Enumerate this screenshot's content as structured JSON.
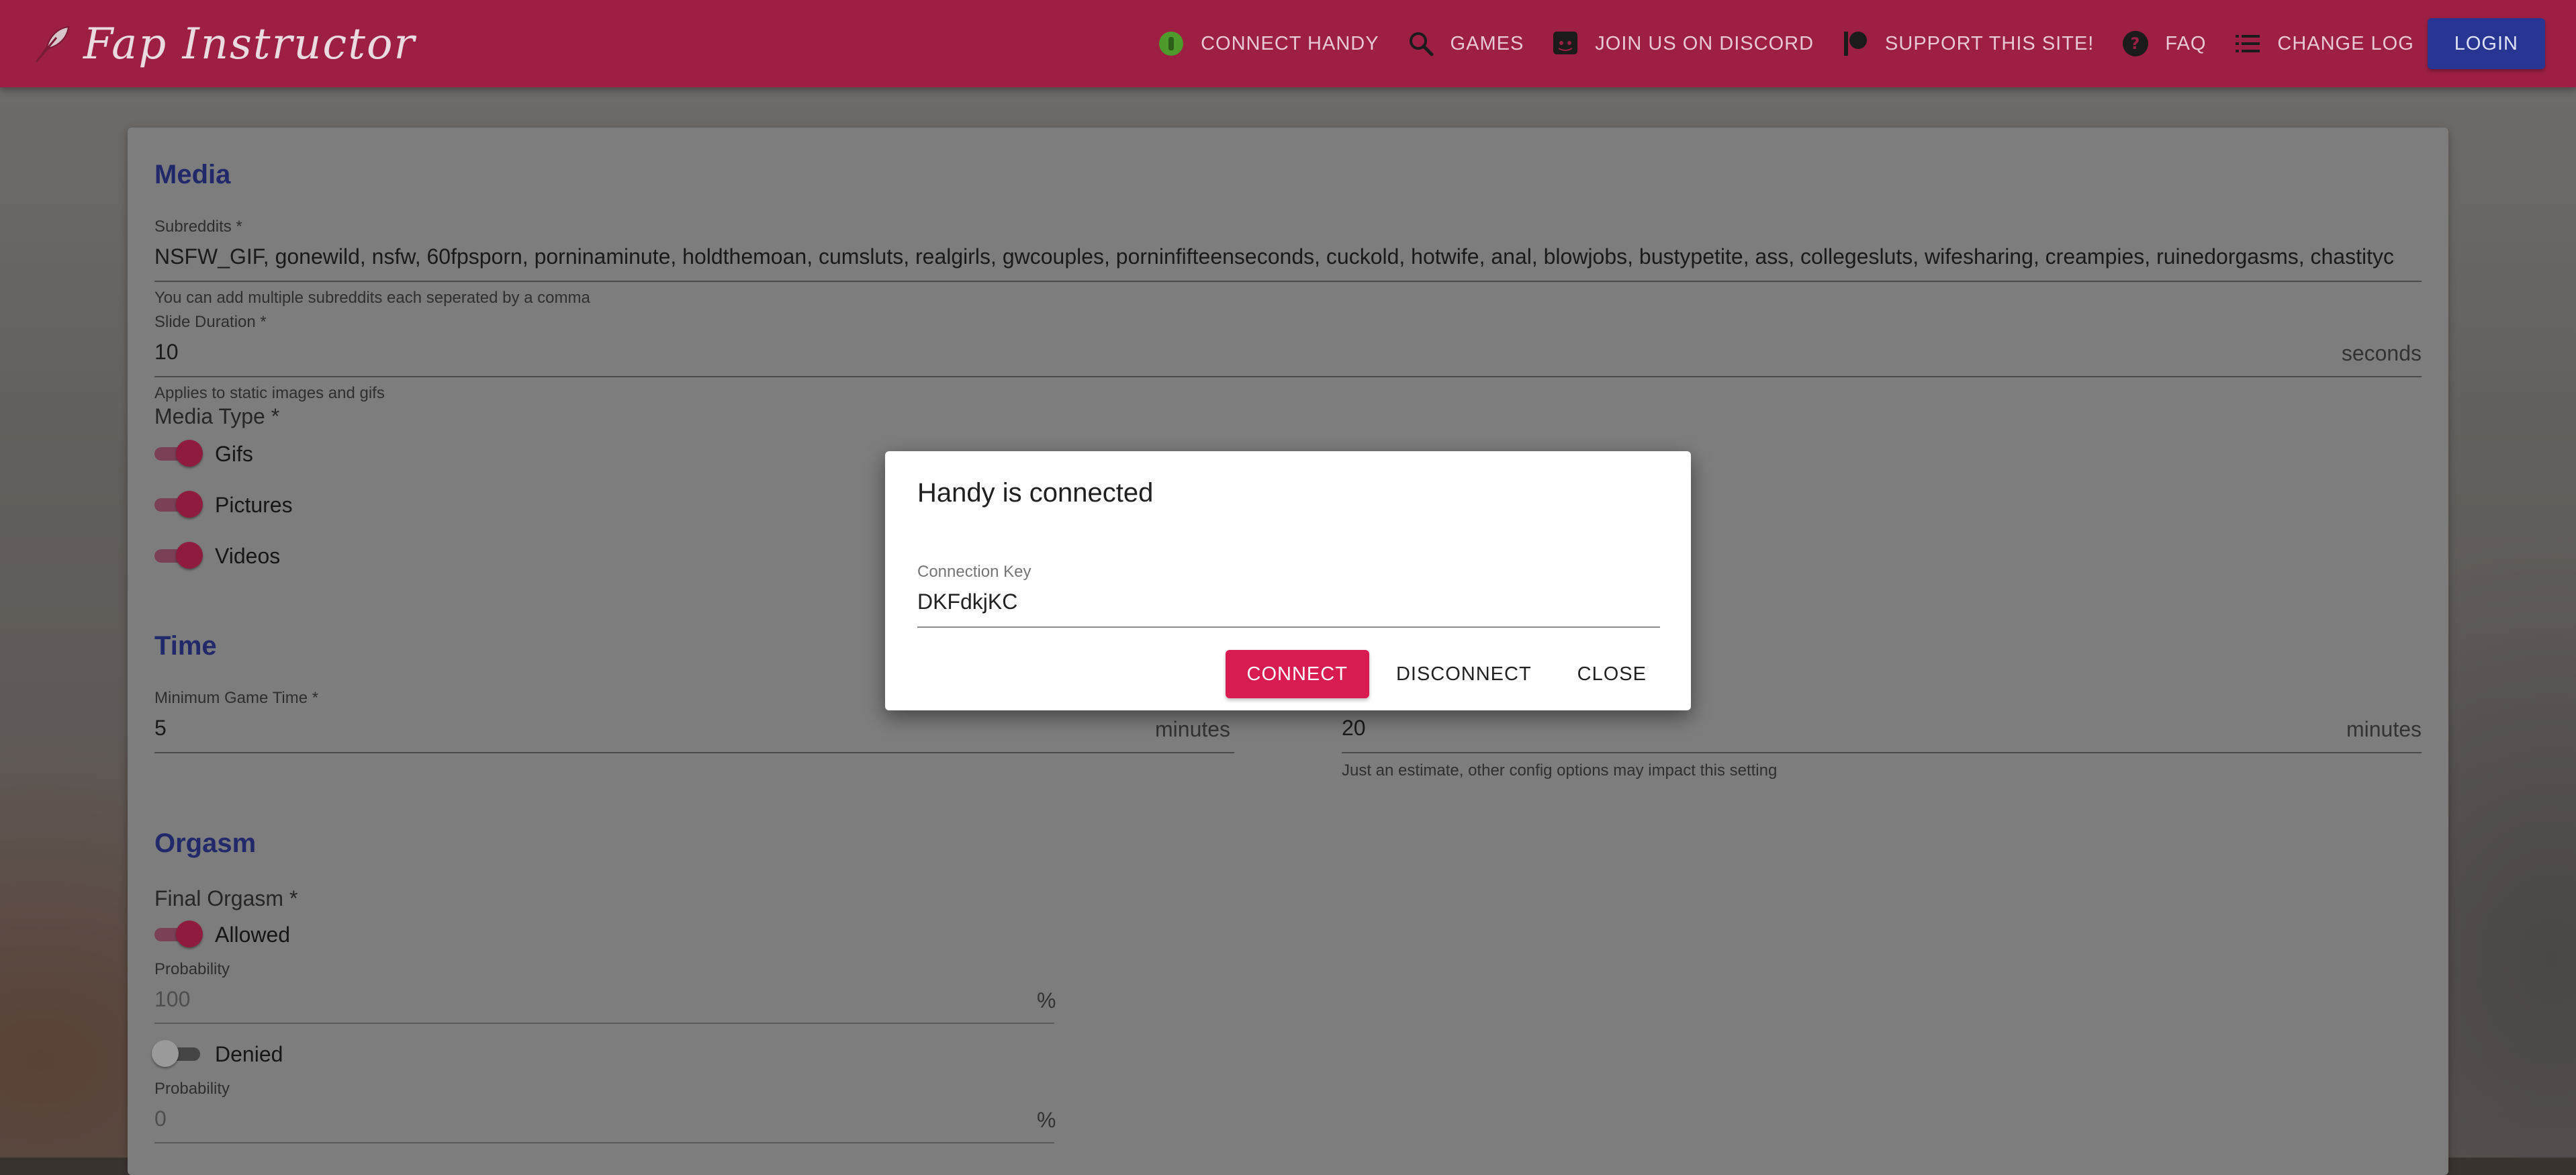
{
  "app": {
    "title": "Fap Instructor"
  },
  "nav": {
    "items": [
      {
        "label": "CONNECT HANDY",
        "icon": "handy-status-icon"
      },
      {
        "label": "GAMES",
        "icon": "search-icon"
      },
      {
        "label": "JOIN US ON DISCORD",
        "icon": "discord-icon"
      },
      {
        "label": "SUPPORT THIS SITE!",
        "icon": "patreon-icon"
      },
      {
        "label": "FAQ",
        "icon": "help-icon"
      },
      {
        "label": "CHANGE LOG",
        "icon": "list-icon"
      }
    ],
    "login": "LOGIN"
  },
  "media": {
    "title": "Media",
    "subreddits": {
      "label": "Subreddits *",
      "value": "NSFW_GIF, gonewild, nsfw, 60fpsporn, porninaminute, holdthemoan, cumsluts, realgirls, gwcouples, porninfifteenseconds, cuckold, hotwife, anal, blowjobs, bustypetite, ass, collegesluts, wifesharing, creampies, ruinedorgasms, chastityc",
      "helper": "You can add multiple subreddits each seperated by a comma"
    },
    "slide_duration": {
      "label": "Slide Duration *",
      "value": "10",
      "suffix": "seconds",
      "helper": "Applies to static images and gifs"
    },
    "media_type": {
      "label": "Media Type *",
      "options": [
        {
          "label": "Gifs",
          "on": true
        },
        {
          "label": "Pictures",
          "on": true
        },
        {
          "label": "Videos",
          "on": true
        }
      ]
    }
  },
  "time": {
    "title": "Time",
    "min_game_time": {
      "label": "Minimum Game Time *",
      "value": "5",
      "suffix": "minutes"
    },
    "max_game_time": {
      "value": "20",
      "suffix": "minutes",
      "helper": "Just an estimate, other config options may impact this setting"
    }
  },
  "orgasm": {
    "title": "Orgasm",
    "final_label": "Final Orgasm *",
    "allowed": {
      "label": "Allowed",
      "on": true,
      "prob_label": "Probability",
      "prob_value": "100",
      "suffix": "%"
    },
    "denied": {
      "label": "Denied",
      "on": false,
      "prob_label": "Probability",
      "prob_value": "0",
      "suffix": "%"
    }
  },
  "dialog": {
    "title": "Handy is connected",
    "key_label": "Connection Key",
    "key_value": "DKFdkjKC",
    "buttons": {
      "connect": "CONNECT",
      "disconnect": "DISCONNECT",
      "close": "CLOSE"
    }
  },
  "colors": {
    "appbar": "#9d1f44",
    "login": "#283593",
    "primary_button": "#d81b50",
    "section_title": "#21296a"
  }
}
